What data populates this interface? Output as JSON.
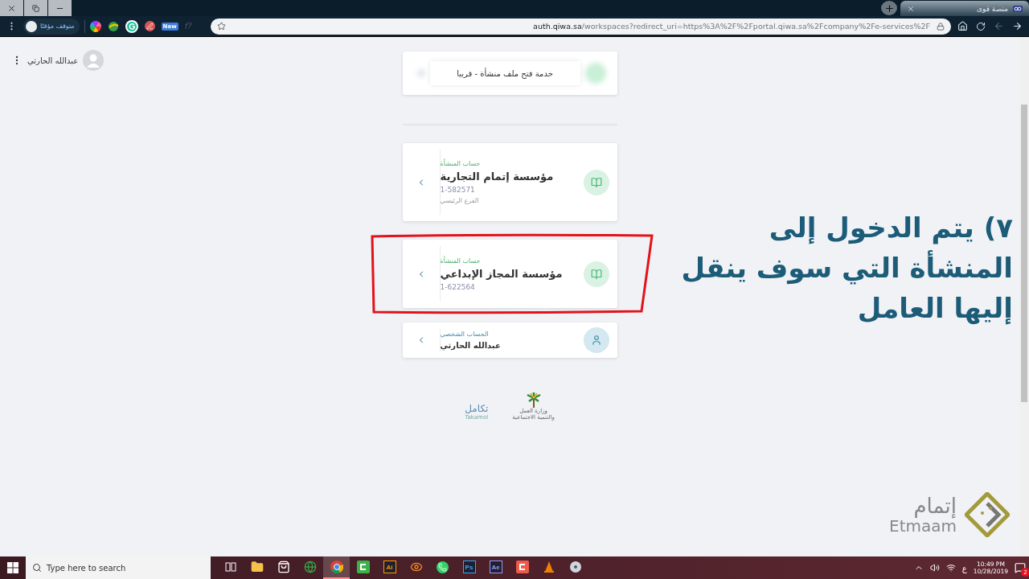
{
  "browser": {
    "window_controls": [
      {
        "kind": "close"
      },
      {
        "kind": "restore"
      },
      {
        "kind": "minimize"
      }
    ],
    "tab": {
      "title": "منصة قوى",
      "selected": true
    },
    "profile": {
      "label": "متوقف مؤقتًا"
    },
    "extensions": [
      {
        "kind": "text",
        "label": "f?"
      },
      {
        "kind": "badge",
        "label": "New"
      },
      {
        "kind": "pen"
      },
      {
        "kind": "grammarly"
      },
      {
        "kind": "globe"
      },
      {
        "kind": "color-wheel"
      }
    ],
    "address": {
      "host": "auth.qiwa.sa",
      "path": "/workspaces?redirect_uri=https%3A%2F%2Fportal.qiwa.sa%2Fcompany%2Fe-services%2F"
    }
  },
  "user": {
    "name": "عبدالله الحارثي"
  },
  "notice": {
    "text": "خدمة فتح ملف منشأة - قريبا"
  },
  "accounts": [
    {
      "kind": "establishment",
      "label": "حساب المنشأة",
      "name": "مؤسسة إتمام التجارية",
      "number": "1-582571",
      "branch": "الفرع الرئيسي",
      "highlighted": false
    },
    {
      "kind": "establishment",
      "label": "حساب المنشأة",
      "name": "مؤسسة المجاز الإبداعي",
      "number": "1-622564",
      "highlighted": true
    },
    {
      "kind": "personal",
      "label": "الحساب الشخصي",
      "name": "عبدالله الحارثي",
      "highlighted": false
    }
  ],
  "footer_logos": {
    "takamol": {
      "name": "تكامل",
      "latin": "Takamol"
    },
    "ministry": {
      "line_1": "وزارة العمل",
      "line_2": "والتنمية الاجتماعية"
    }
  },
  "annotation": {
    "lines": [
      "٧) يتم الدخول إلى",
      "المنشأة التي سوف ينقل",
      "إليها العامل"
    ]
  },
  "branding": {
    "arabic": "إتمام",
    "latin": "Etmaam"
  },
  "taskbar": {
    "search": {
      "placeholder": "Type here to search"
    },
    "apps": [
      {
        "kind": "disc",
        "active": false
      },
      {
        "kind": "vlc",
        "active": false
      },
      {
        "kind": "camtasia-red",
        "active": false
      },
      {
        "kind": "tile",
        "label": "Ae",
        "color": "#9999ff",
        "active": false
      },
      {
        "kind": "tile",
        "label": "Ps",
        "color": "#31a8ff",
        "active": false
      },
      {
        "kind": "whatsapp",
        "active": false
      },
      {
        "kind": "eye",
        "active": false
      },
      {
        "kind": "tile",
        "label": "Ai",
        "color": "#ff9a00",
        "active": false
      },
      {
        "kind": "camtasia",
        "active": false
      },
      {
        "kind": "chrome",
        "active": true
      },
      {
        "kind": "globe",
        "active": false
      },
      {
        "kind": "store",
        "active": false
      },
      {
        "kind": "folder",
        "active": false
      },
      {
        "kind": "task-view",
        "active": false
      }
    ],
    "tray": {
      "language": "ع",
      "time": "10:49 PM",
      "date": "10/28/2019",
      "notifications": "2"
    }
  }
}
